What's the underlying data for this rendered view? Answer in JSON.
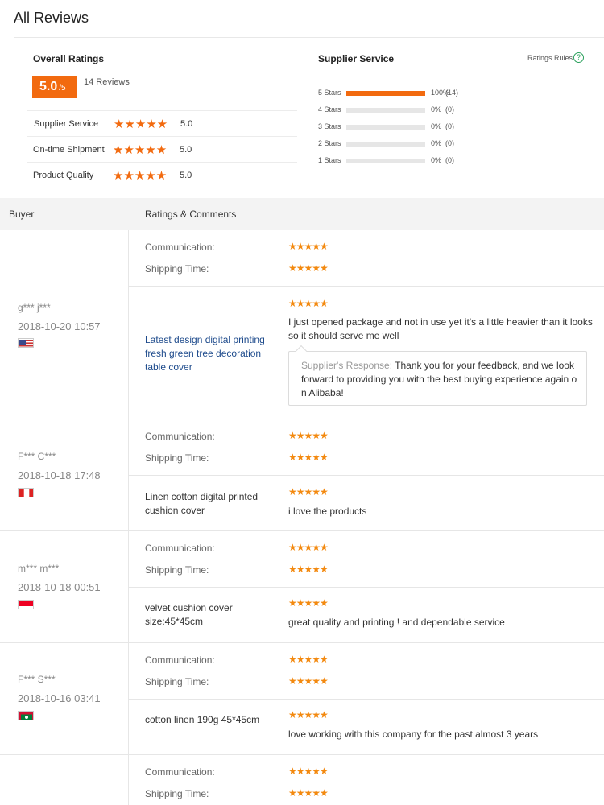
{
  "page": {
    "title": "All Reviews"
  },
  "overall": {
    "title": "Overall Ratings",
    "score": "5.0",
    "score_suffix": "/5",
    "review_count": "14 Reviews",
    "rows": [
      {
        "label": "Supplier Service",
        "stars": "★★★★★",
        "value": "5.0"
      },
      {
        "label": "On-time Shipment",
        "stars": "★★★★★",
        "value": "5.0"
      },
      {
        "label": "Product Quality",
        "stars": "★★★★★",
        "value": "5.0"
      }
    ]
  },
  "supplier_service": {
    "title": "Supplier Service",
    "rules_label": "Ratings Rules",
    "help_icon": "?",
    "distribution": [
      {
        "label": "5 Stars",
        "percent": "100%",
        "count": "(14)",
        "fill": 1.0
      },
      {
        "label": "4 Stars",
        "percent": "0%",
        "count": "(0)",
        "fill": 0
      },
      {
        "label": "3 Stars",
        "percent": "0%",
        "count": "(0)",
        "fill": 0
      },
      {
        "label": "2 Stars",
        "percent": "0%",
        "count": "(0)",
        "fill": 0
      },
      {
        "label": "1 Stars",
        "percent": "0%",
        "count": "(0)",
        "fill": 0
      }
    ]
  },
  "table": {
    "col_buyer": "Buyer",
    "col_ratings": "Ratings & Comments"
  },
  "labels": {
    "communication": "Communication:",
    "shipping": "Shipping Time:",
    "stars": "★★★★★",
    "response_label": "Supplier's Response:"
  },
  "reviews": [
    {
      "buyer": "g*** j***",
      "date": "2018-10-20 10:57",
      "flag": "us",
      "product": "Latest design digital printing fresh green tree decoration table cover",
      "comment": "I just opened package and not in use yet it's a little heavier than it looks so it should serve me well",
      "response": "Thank you for your feedback, and we look forward to providing you with the best buying experience again on Alibaba!"
    },
    {
      "buyer": "F*** C***",
      "date": "2018-10-18 17:48",
      "flag": "pe",
      "product": "Linen cotton digital printed cushion cover",
      "comment": "i love the products"
    },
    {
      "buyer": "m*** m***",
      "date": "2018-10-18 00:51",
      "flag": "sg",
      "product": "velvet cushion cover size:45*45cm",
      "comment": "great quality and printing ! and dependable service"
    },
    {
      "buyer": "F*** S***",
      "date": "2018-10-16 03:41",
      "flag": "mv",
      "product": "cotton linen 190g 45*45cm",
      "comment": "love working with this company for the past almost 3 years"
    }
  ]
}
